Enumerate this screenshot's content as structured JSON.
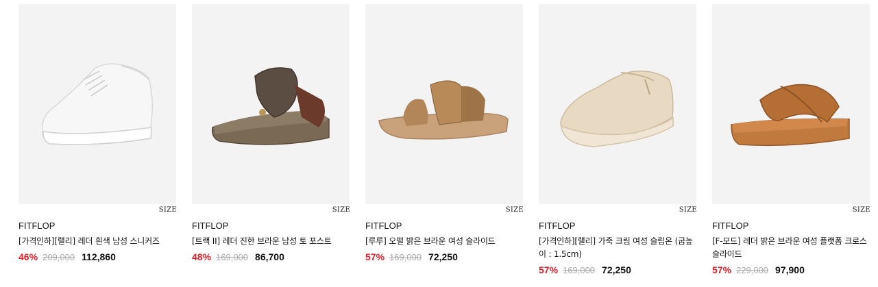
{
  "products": [
    {
      "brand": "FITFLOP",
      "name": "[가격인하][랠리] 레더 흰색 남성 스니커즈",
      "discount": "46%",
      "original_price": "209,000",
      "sale_price": "112,860",
      "size_label": "SIZE",
      "image_icon": "white-sneaker-image"
    },
    {
      "brand": "FITFLOP",
      "name": "[트랙 II] 레더 진한 브라운 남성 토 포스트",
      "discount": "48%",
      "original_price": "169,000",
      "sale_price": "86,700",
      "size_label": "SIZE",
      "image_icon": "brown-toe-post-sandal-image"
    },
    {
      "brand": "FITFLOP",
      "name": "[루루] 오펄 밝은 브라운 여성 슬라이드",
      "discount": "57%",
      "original_price": "169,000",
      "sale_price": "72,250",
      "size_label": "SIZE",
      "image_icon": "bronze-slide-sandal-image"
    },
    {
      "brand": "FITFLOP",
      "name": "[가격인하][랠리] 가죽 크림 여성 슬립온 (굽높이 : 1.5cm)",
      "discount": "57%",
      "original_price": "169,000",
      "sale_price": "72,250",
      "size_label": "SIZE",
      "image_icon": "cream-slip-on-image"
    },
    {
      "brand": "FITFLOP",
      "name": "[F-모드] 레더 밝은 브라운 여성 플랫폼 크로스 슬라이드",
      "discount": "57%",
      "original_price": "229,000",
      "sale_price": "97,900",
      "size_label": "SIZE",
      "image_icon": "tan-cross-slide-image"
    }
  ],
  "colors": {
    "discount": "#e0202a",
    "original_price": "#aaaaaa",
    "thumb_bg": "#f3f3f3"
  }
}
